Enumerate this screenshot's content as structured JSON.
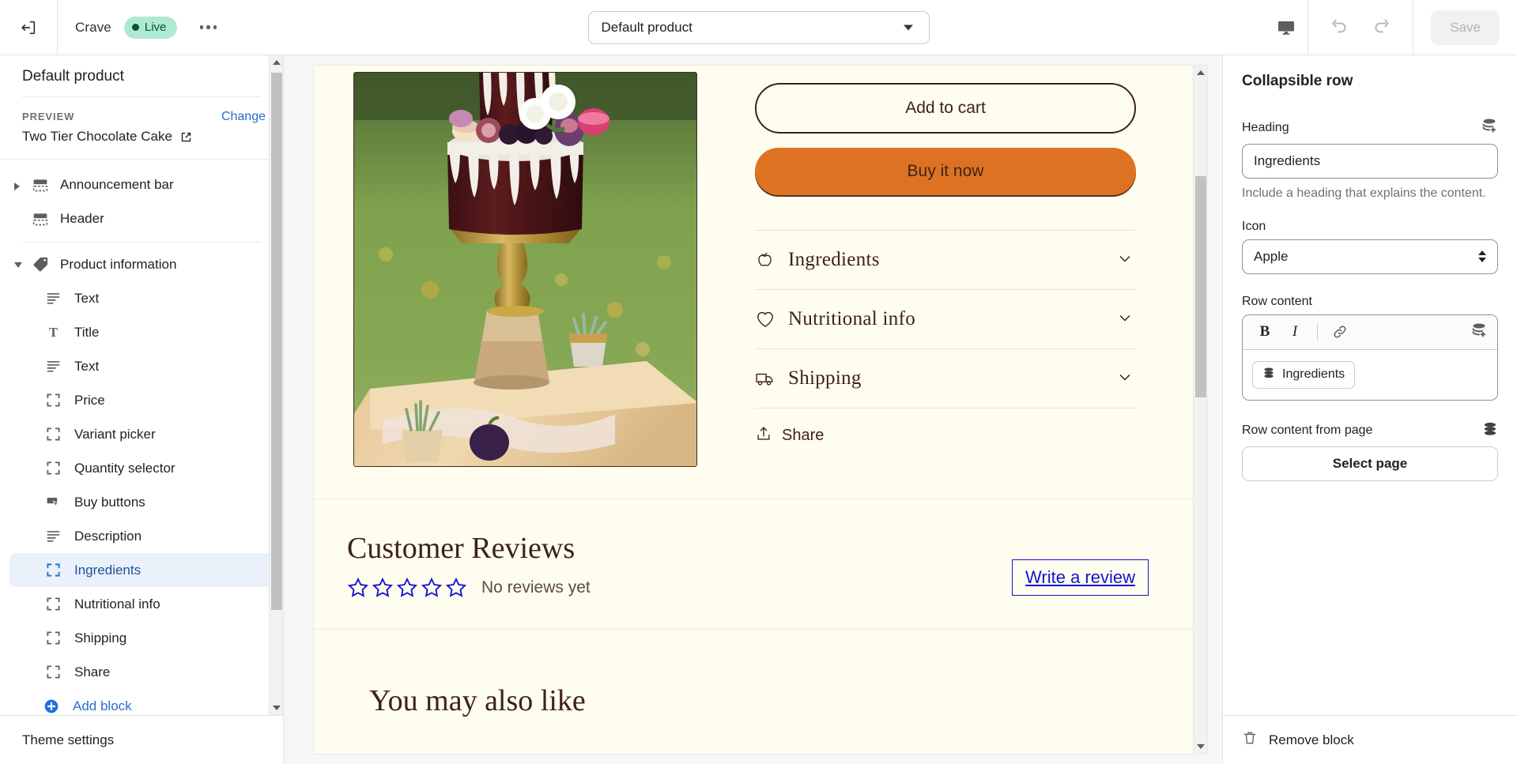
{
  "topbar": {
    "back_icon": "exit-arrow-icon",
    "store_name": "Crave",
    "status_badge": "Live",
    "more_icon": "ellipsis-icon",
    "product_selector_value": "Default product",
    "device_icon": "desktop-icon",
    "undo_icon": "undo-icon",
    "redo_icon": "redo-icon",
    "save_label": "Save"
  },
  "sidebar": {
    "title": "Default product",
    "preview_label": "PREVIEW",
    "preview_value": "Two Tier Chocolate Cake",
    "change_label": "Change",
    "external_icon": "external-link-icon",
    "sections": [
      {
        "label": "Announcement bar",
        "icon": "section-icon",
        "caret": "collapsed",
        "level": "top"
      },
      {
        "label": "Header",
        "icon": "section-icon",
        "caret": "none",
        "level": "top"
      },
      {
        "label": "Product information",
        "icon": "tag-icon",
        "caret": "expanded",
        "level": "top"
      },
      {
        "label": "Text",
        "icon": "text-lines-icon",
        "level": "child"
      },
      {
        "label": "Title",
        "icon": "title-T-icon",
        "level": "child"
      },
      {
        "label": "Text",
        "icon": "text-lines-icon",
        "level": "child"
      },
      {
        "label": "Price",
        "icon": "block-brackets-icon",
        "level": "child"
      },
      {
        "label": "Variant picker",
        "icon": "block-brackets-icon",
        "level": "child"
      },
      {
        "label": "Quantity selector",
        "icon": "block-brackets-icon",
        "level": "child"
      },
      {
        "label": "Buy buttons",
        "icon": "cursor-button-icon",
        "level": "child"
      },
      {
        "label": "Description",
        "icon": "text-lines-icon",
        "level": "child"
      },
      {
        "label": "Ingredients",
        "icon": "block-brackets-icon",
        "level": "child",
        "selected": true
      },
      {
        "label": "Nutritional info",
        "icon": "block-brackets-icon",
        "level": "child"
      },
      {
        "label": "Shipping",
        "icon": "block-brackets-icon",
        "level": "child"
      },
      {
        "label": "Share",
        "icon": "block-brackets-icon",
        "level": "child"
      },
      {
        "label": "Add block",
        "icon": "plus-circle-icon",
        "level": "add"
      }
    ],
    "footer_label": "Theme settings"
  },
  "preview": {
    "add_to_cart_label": "Add to cart",
    "buy_it_now_label": "Buy it now",
    "product_image_alt": "two-tier-chocolate-cake-photo",
    "collapsible_rows": [
      {
        "label": "Ingredients",
        "icon": "apple-icon",
        "chevron": "chevron-down-icon"
      },
      {
        "label": "Nutritional info",
        "icon": "heart-icon",
        "chevron": "chevron-down-icon"
      },
      {
        "label": "Shipping",
        "icon": "truck-icon",
        "chevron": "chevron-down-icon"
      }
    ],
    "share_label": "Share",
    "share_icon": "share-upload-icon",
    "reviews": {
      "title": "Customer Reviews",
      "stars": 5,
      "stars_filled": 0,
      "empty_text": "No reviews yet",
      "write_label": "Write a review"
    },
    "also_like_title": "You may also like"
  },
  "settings": {
    "panel_title": "Collapsible row",
    "heading_label": "Heading",
    "heading_value": "Ingredients",
    "heading_dynamic_icon": "dynamic-source-add-icon",
    "heading_help": "Include a heading that explains the content.",
    "icon_label": "Icon",
    "icon_value": "Apple",
    "row_content_label": "Row content",
    "rte_bold": "B",
    "rte_italic": "I",
    "rte_link_icon": "link-icon",
    "rte_dynamic_icon": "dynamic-source-add-icon",
    "rte_chip_label": "Ingredients",
    "rte_chip_icon": "dynamic-source-icon",
    "row_from_page_label": "Row content from page",
    "row_from_page_icon": "dynamic-source-icon",
    "select_page_label": "Select page",
    "remove_block_label": "Remove block",
    "remove_icon": "trash-icon"
  },
  "colors": {
    "accent_blue": "#2c6ecb",
    "live_badge_bg": "#aee9d1",
    "live_badge_text": "#0c5132",
    "preview_bg": "#fffdf0",
    "brand_brown": "#3d2314",
    "buy_orange": "#dd7322",
    "link_blue": "#1414d0"
  }
}
